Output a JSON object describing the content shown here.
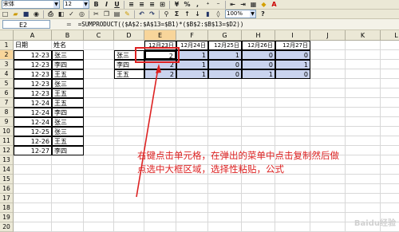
{
  "toolbar": {
    "font_name": "宋体",
    "font_size": "12",
    "bold": "B",
    "italic": "I",
    "underline": "U",
    "percent": "%",
    "zoom": "100%"
  },
  "formula_bar": {
    "name_box": "E2",
    "fx": "=",
    "formula": "=SUMPRODUCT(($A$2:$A$13=$B1)*($B$2:$B$13=$D2))"
  },
  "grid": {
    "columns": [
      "A",
      "B",
      "C",
      "D",
      "E",
      "F",
      "G",
      "H",
      "I",
      "J",
      "K",
      "L"
    ],
    "rows": [
      "1",
      "2",
      "3",
      "4",
      "5",
      "6",
      "7",
      "8",
      "9",
      "10",
      "11",
      "12",
      "13",
      "14",
      "15",
      "16",
      "17",
      "18",
      "19",
      "20"
    ],
    "header_row": {
      "A": "日期",
      "B": "姓名"
    },
    "list_data": [
      [
        "12-23",
        "张三"
      ],
      [
        "12-23",
        "李四"
      ],
      [
        "12-23",
        "王五"
      ],
      [
        "12-23",
        "张三"
      ],
      [
        "12-23",
        "王五"
      ],
      [
        "12-24",
        "王五"
      ],
      [
        "12-24",
        "李四"
      ],
      [
        "12-24",
        "张三"
      ],
      [
        "12-25",
        "张三"
      ],
      [
        "12-26",
        "王五"
      ],
      [
        "12-27",
        "李四"
      ]
    ],
    "date_headers": [
      "12月23日",
      "12月24日",
      "12月25日",
      "12月26日",
      "12月27日"
    ],
    "names": [
      "张三",
      "李四",
      "王五"
    ],
    "matrix": [
      [
        2,
        1,
        1,
        0,
        0
      ],
      [
        2,
        1,
        0,
        0,
        1
      ],
      [
        2,
        1,
        0,
        1,
        0
      ]
    ]
  },
  "annotation": {
    "line1": "右键点击单元格，在弹出的菜单中点击复制然后做",
    "line2": "点选中大框区域，选择性粘贴，公式"
  },
  "watermark": "Baidu经验",
  "colors": {
    "arrow": "#dd2222",
    "selection_header": "#f8d59a",
    "range_highlight": "#c9d3ee"
  }
}
